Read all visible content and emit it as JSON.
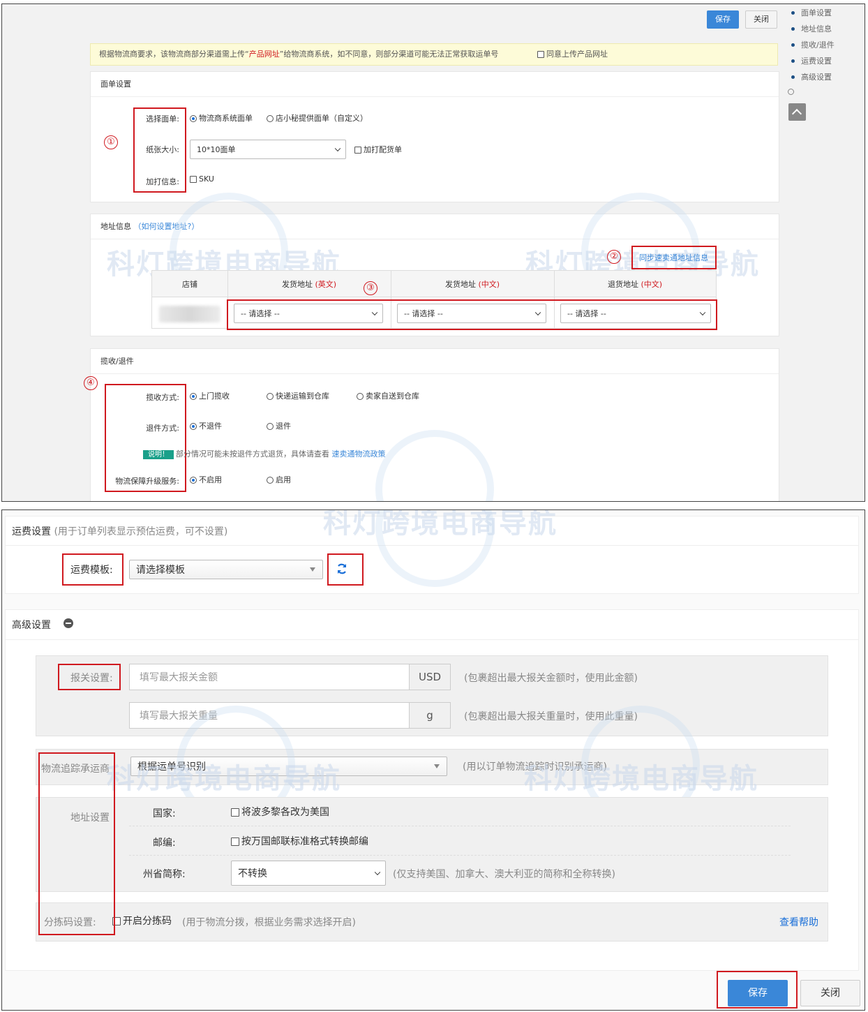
{
  "top": {
    "save_label": "保存",
    "close_label": "关闭"
  },
  "side_nav": {
    "items": [
      "面单设置",
      "地址信息",
      "揽收/退件",
      "运费设置",
      "高级设置"
    ]
  },
  "notice": {
    "text_before": "根据物流商要求，该物流商部分渠道需上传“",
    "highlight": "产品网址",
    "text_after": "”给物流商系统，如不同意，则部分渠道可能无法正常获取运单号",
    "agree_label": "同意上传产品网址"
  },
  "label_settings": {
    "title": "面单设置",
    "select_label": "选择面单:",
    "option_1": "物流商系统面单",
    "option_2": "店小秘提供面单（自定义）",
    "paper_label": "纸张大小:",
    "paper_value": "10*10面单",
    "extra_print_label": "加打配货单",
    "print_info_label": "加打信息:",
    "sku_label": "SKU"
  },
  "address": {
    "title": "地址信息",
    "help_open": "（",
    "help_link": "如何设置地址?",
    "help_close": "）",
    "sync_label": "同步速卖通地址信息",
    "col_store": "店铺",
    "col_ship_en": "发货地址",
    "col_ship_en_tag": "(英文)",
    "col_ship_cn": "发货地址",
    "col_ship_cn_tag": "(中文)",
    "col_return_cn": "退货地址",
    "col_return_cn_tag": "(中文)",
    "select_placeholder": "-- 请选择 --"
  },
  "pickup": {
    "title": "揽收/退件",
    "pickup_label": "揽收方式:",
    "pickup_opt_1": "上门揽收",
    "pickup_opt_2": "快递运输到仓库",
    "pickup_opt_3": "卖家自送到仓库",
    "return_label": "退件方式:",
    "return_opt_1": "不退件",
    "return_opt_2": "退件",
    "note_badge": "说明！",
    "note_text": "部分情况可能未按退件方式退货，具体请查看",
    "note_link": "速卖通物流政策",
    "upgrade_label": "物流保障升级服务:",
    "upgrade_opt_1": "不启用",
    "upgrade_opt_2": "启用"
  },
  "markers": [
    "①",
    "②",
    "③",
    "④"
  ],
  "freight": {
    "title": "运费设置",
    "hint": "(用于订单列表显示预估运费，可不设置)",
    "template_label": "运费模板:",
    "template_value": "请选择模板"
  },
  "advanced": {
    "title": "高级设置",
    "customs_label": "报关设置:",
    "amount_placeholder": "填写最大报关金额",
    "amount_unit": "USD",
    "amount_hint": "(包裹超出最大报关金额时，使用此金额)",
    "weight_placeholder": "填写最大报关重量",
    "weight_unit": "g",
    "weight_hint": "(包裹超出最大报关重量时，使用此重量)",
    "carrier_label": "物流追踪承运商",
    "carrier_value": "根据运单号识别",
    "carrier_hint": "(用以订单物流追踪时识别承运商)",
    "addr_label": "地址设置",
    "country_label": "国家:",
    "country_opt": "将波多黎各改为美国",
    "zip_label": "邮编:",
    "zip_opt": "按万国邮联标准格式转换邮编",
    "state_label": "州省简称:",
    "state_value": "不转换",
    "state_hint": "(仅支持美国、加拿大、澳大利亚的简称和全称转换)",
    "sort_label": "分拣码设置:",
    "sort_opt": "开启分拣码",
    "sort_hint": "(用于物流分拨，根据业务需求选择开启)",
    "help_link": "查看帮助"
  },
  "bottom": {
    "save_label": "保存",
    "close_label": "关闭"
  },
  "watermark": "科灯跨境电商导航",
  "colors": {
    "primary": "#3a87d8",
    "annotation_red": "#d0191f",
    "notice_bg": "#fdfbd8",
    "note_badge_bg": "#1aa08a"
  }
}
